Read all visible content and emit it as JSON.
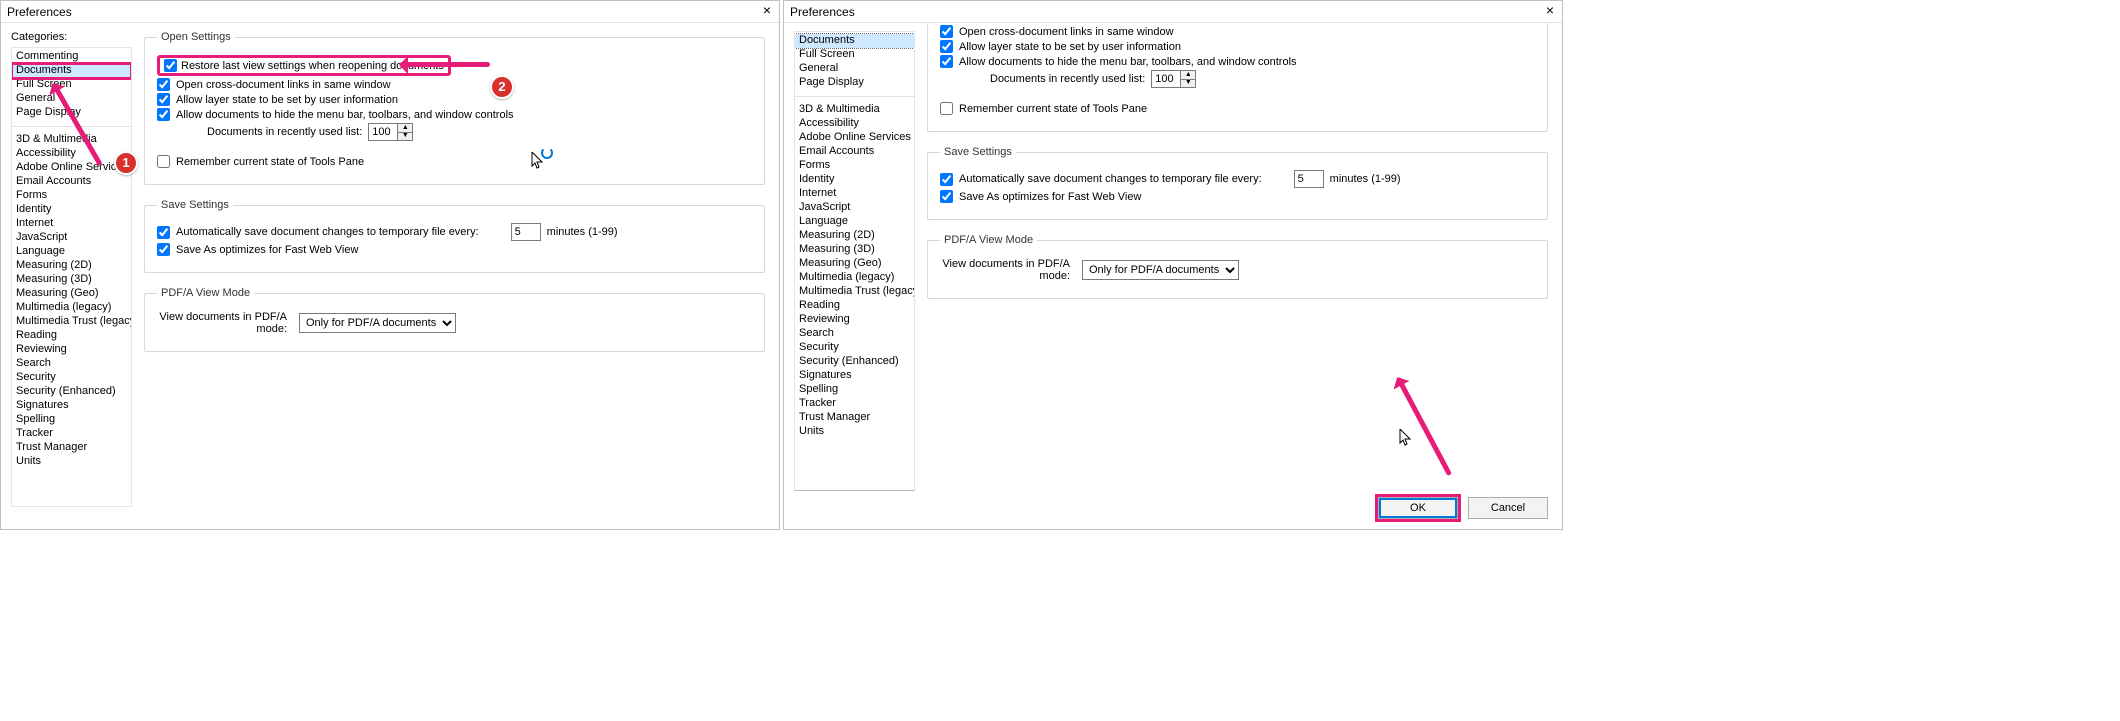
{
  "title": "Preferences",
  "categories_label": "Categories:",
  "group1": [
    "Commenting",
    "Documents",
    "Full Screen",
    "General",
    "Page Display"
  ],
  "group2": [
    "3D & Multimedia",
    "Accessibility",
    "Adobe Online Services",
    "Email Accounts",
    "Forms",
    "Identity",
    "Internet",
    "JavaScript",
    "Language",
    "Measuring (2D)",
    "Measuring (3D)",
    "Measuring (Geo)",
    "Multimedia (legacy)",
    "Multimedia Trust (legacy)",
    "Reading",
    "Reviewing",
    "Search",
    "Security",
    "Security (Enhanced)",
    "Signatures",
    "Spelling",
    "Tracker",
    "Trust Manager",
    "Units"
  ],
  "group1r": [
    "Documents",
    "Full Screen",
    "General",
    "Page Display"
  ],
  "open": {
    "legend": "Open Settings",
    "restore": "Restore last view settings when reopening documents",
    "crosslinks": "Open cross-document links in same window",
    "layer": "Allow layer state to be set by user information",
    "hidemenu": "Allow documents to hide the menu bar, toolbars, and window controls",
    "recent_label": "Documents in recently used list:",
    "recent_value": "100",
    "toolspane": "Remember current state of Tools Pane"
  },
  "save": {
    "legend": "Save Settings",
    "auto": "Automatically save document changes to temporary file every:",
    "minutes_val": "5",
    "minutes_suffix": "minutes (1-99)",
    "fastweb": "Save As optimizes for Fast Web View"
  },
  "pdfa": {
    "legend": "PDF/A View Mode",
    "label": "View documents in PDF/A mode:",
    "value": "Only for PDF/A documents"
  },
  "ok": "OK",
  "cancel": "Cancel",
  "badge1": "1",
  "badge2": "2"
}
